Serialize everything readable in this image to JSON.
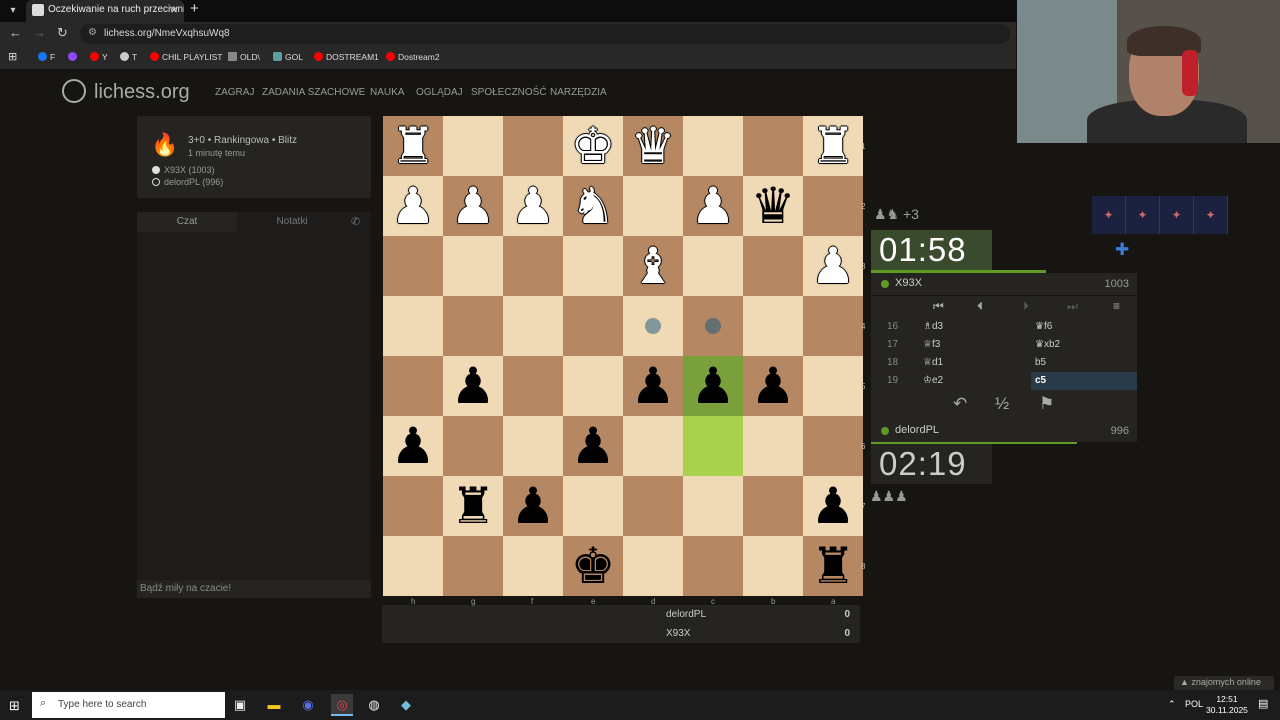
{
  "browser": {
    "tab_title": "Oczekiwanie na ruch przeciwnika",
    "url": "lichess.org/NmeVxqhsuWq8",
    "bookmarks": [
      {
        "label": "F",
        "color": "#1877f2"
      },
      {
        "label": "",
        "color": "#9146ff"
      },
      {
        "label": "Y",
        "color": "#ff0000"
      },
      {
        "label": "T",
        "color": "#cccccc"
      },
      {
        "label": "CHIL PLAYLIST",
        "color": "#ff0000"
      },
      {
        "label": "OLD\\",
        "color": "#888888"
      },
      {
        "label": "GOL",
        "color": "#5aa0a0"
      },
      {
        "label": "DOSTREAM1",
        "color": "#ff0000"
      },
      {
        "label": "Dostream2",
        "color": "#ff0000"
      }
    ]
  },
  "site": {
    "logo": "lichess.org",
    "nav": [
      "ZAGRAJ",
      "ZADANIA SZACHOWE",
      "NAUKA",
      "OGLĄDAJ",
      "SPOŁECZNOŚĆ",
      "NARZĘDZIA"
    ]
  },
  "game": {
    "meta": "3+0 • Rankingowa • Blitz",
    "ago": "1 minutę temu",
    "white_player": "X93X (1003)",
    "black_player": "delordPL (996)"
  },
  "chat": {
    "tab_chat": "Czat",
    "tab_notes": "Notatki",
    "placeholder": "Bądź miły na czacie!"
  },
  "board": {
    "files": [
      "h",
      "g",
      "f",
      "e",
      "d",
      "c",
      "b",
      "a"
    ],
    "ranks": [
      "1",
      "2",
      "3",
      "4",
      "5",
      "6",
      "7",
      "8"
    ],
    "pieces": [
      {
        "sq": "h1",
        "g": "♜",
        "c": "w"
      },
      {
        "sq": "e1",
        "g": "♚",
        "c": "w"
      },
      {
        "sq": "d1",
        "g": "♛",
        "c": "w"
      },
      {
        "sq": "a1",
        "g": "♜",
        "c": "w"
      },
      {
        "sq": "h2",
        "g": "♟",
        "c": "w"
      },
      {
        "sq": "g2",
        "g": "♟",
        "c": "w"
      },
      {
        "sq": "f2",
        "g": "♟",
        "c": "w"
      },
      {
        "sq": "e2",
        "g": "♞",
        "c": "w"
      },
      {
        "sq": "c2",
        "g": "♟",
        "c": "w"
      },
      {
        "sq": "b2",
        "g": "♛",
        "c": "b"
      },
      {
        "sq": "d3",
        "g": "♝",
        "c": "w"
      },
      {
        "sq": "a3",
        "g": "♟",
        "c": "w"
      },
      {
        "sq": "g5",
        "g": "♟",
        "c": "b"
      },
      {
        "sq": "d5",
        "g": "♟",
        "c": "b"
      },
      {
        "sq": "c5",
        "g": "♟",
        "c": "b"
      },
      {
        "sq": "b5",
        "g": "♟",
        "c": "b"
      },
      {
        "sq": "h6",
        "g": "♟",
        "c": "b"
      },
      {
        "sq": "e6",
        "g": "♟",
        "c": "b"
      },
      {
        "sq": "g7",
        "g": "♜",
        "c": "b"
      },
      {
        "sq": "f7",
        "g": "♟",
        "c": "b"
      },
      {
        "sq": "a7",
        "g": "♟",
        "c": "b"
      },
      {
        "sq": "e8",
        "g": "♚",
        "c": "b"
      },
      {
        "sq": "a8",
        "g": "♜",
        "c": "b"
      }
    ],
    "highlights": [
      {
        "sq": "c5",
        "kind": "to"
      },
      {
        "sq": "c6",
        "kind": "from"
      }
    ],
    "move_dots": [
      "d4",
      "c4"
    ]
  },
  "score": [
    {
      "name": "delordPL",
      "value": "0"
    },
    {
      "name": "X93X",
      "value": "0"
    }
  ],
  "clocks": {
    "top": "01:58",
    "bottom": "02:19",
    "top_material": "♟♞ +3",
    "bottom_material": "♟♟♟"
  },
  "players": {
    "top": {
      "name": "X93X",
      "rating": "1003"
    },
    "bottom": {
      "name": "delordPL",
      "rating": "996"
    }
  },
  "moves": [
    {
      "n": "16",
      "w": "♗d3",
      "b": "♛f6"
    },
    {
      "n": "17",
      "w": "♕f3",
      "b": "♛xb2"
    },
    {
      "n": "18",
      "w": "♕d1",
      "b": "b5"
    },
    {
      "n": "19",
      "w": "♔e2",
      "b": "c5"
    }
  ],
  "controls": [
    "⏮",
    "⏴",
    "⏵",
    "⏭",
    "≡"
  ],
  "actions": [
    "↶",
    "½",
    "⚑"
  ],
  "friends": "▲ znajomych online",
  "taskbar": {
    "search": "Type here to search",
    "lang": "POL",
    "time": "12:51",
    "date": "30.11.2025"
  },
  "colors": {
    "accent_green": "#629924",
    "move_highlight": "#aad14e",
    "light_sq": "#f0d9b5",
    "dark_sq": "#b58863"
  }
}
